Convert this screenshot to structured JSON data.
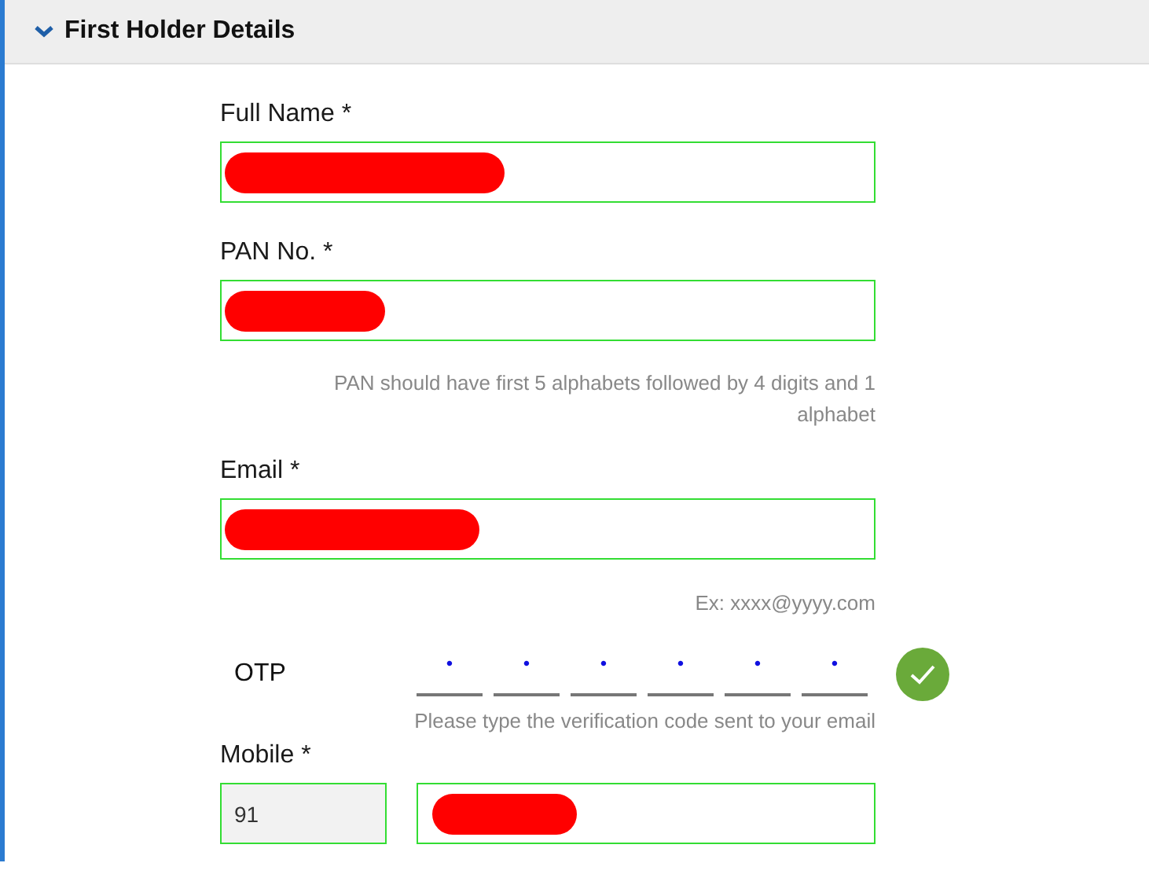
{
  "section": {
    "title": "First Holder Details",
    "expanded": true
  },
  "fields": [
    {
      "kind": "text",
      "label": "Full Name *",
      "valid": true,
      "redacted": true
    },
    {
      "kind": "text",
      "label": "PAN No. *",
      "valid": true,
      "redacted": true,
      "hint": "PAN should have first 5 alphabets followed by 4 digits and 1 alphabet"
    },
    {
      "kind": "text",
      "label": "Email *",
      "valid": true,
      "redacted": true,
      "hint": "Ex: xxxx@yyyy.com"
    },
    {
      "kind": "otp",
      "label": "OTP",
      "digits": [
        "•",
        "•",
        "•",
        "•",
        "•",
        "•"
      ],
      "verified": true,
      "hint": "Please type the verification code sent to your email"
    },
    {
      "kind": "phone",
      "label": "Mobile *",
      "code": "91",
      "valid": true,
      "redacted": true
    }
  ]
}
